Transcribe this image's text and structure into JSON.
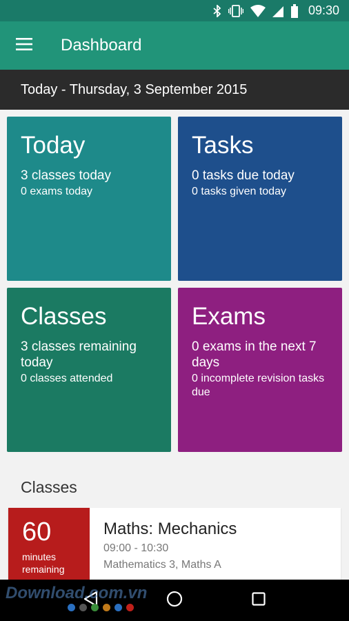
{
  "status_bar": {
    "time": "09:30"
  },
  "app_bar": {
    "title": "Dashboard"
  },
  "date_bar": {
    "text": "Today - Thursday, 3 September 2015"
  },
  "tiles": {
    "today": {
      "title": "Today",
      "line1": "3 classes today",
      "line2": "0 exams today",
      "color": "#1e8a8a"
    },
    "tasks": {
      "title": "Tasks",
      "line1": "0 tasks due today",
      "line2": "0 tasks given today",
      "color": "#1e4f8c"
    },
    "classes": {
      "title": "Classes",
      "line1": "3 classes remaining today",
      "line2": "0 classes attended",
      "color": "#1b7a62"
    },
    "exams": {
      "title": "Exams",
      "line1": "0 exams in the next 7 days",
      "line2": "0 incomplete revision tasks due",
      "color": "#8e1f80"
    }
  },
  "classes_section": {
    "title": "Classes",
    "card": {
      "minutes": "60",
      "minutes_label": "minutes remaining",
      "subject": "Maths: Mechanics",
      "time": "09:00 - 10:30",
      "meta": "Mathematics 3, Maths A",
      "accent": "#b71c1c"
    }
  },
  "watermark": {
    "text": "Download.com.vn"
  },
  "icons": {
    "status": [
      "bluetooth-icon",
      "vibrate-icon",
      "wifi-icon",
      "signal-icon",
      "battery-icon"
    ],
    "nav": [
      "back-icon",
      "home-icon",
      "recents-icon"
    ]
  }
}
